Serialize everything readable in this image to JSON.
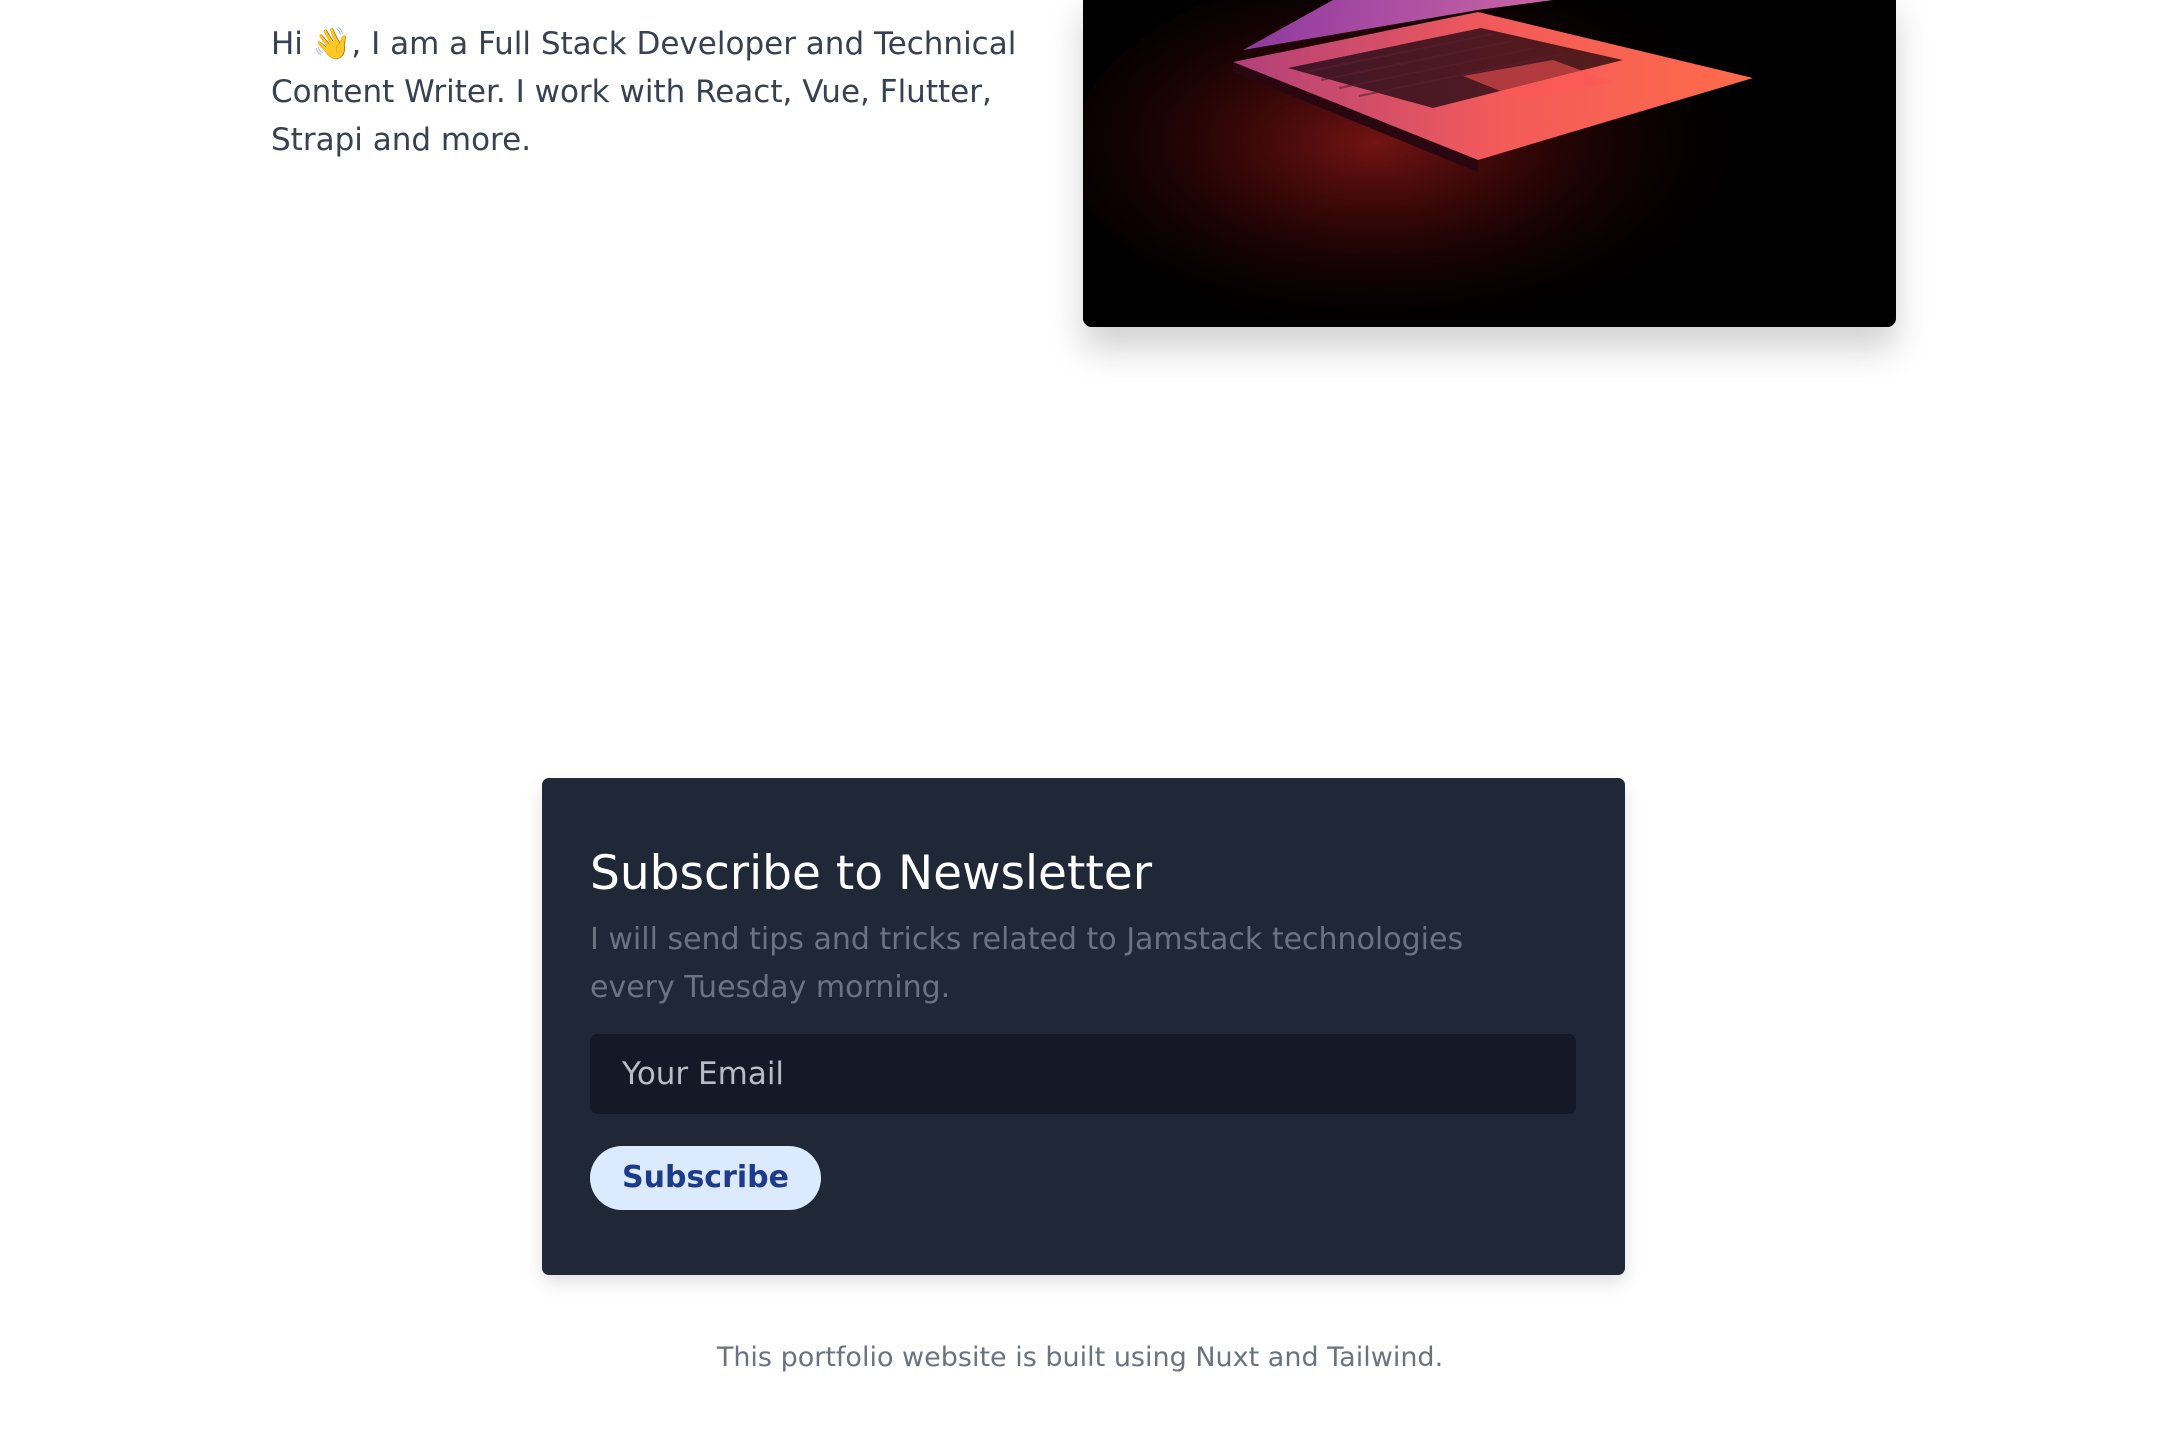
{
  "intro": {
    "text": "Hi 👋, I am a Full Stack Developer and Technical Content Writer. I work with React, Vue, Flutter, Strapi and more."
  },
  "hero_image": {
    "subject": "laptop lit in red and pink light on black background"
  },
  "newsletter": {
    "title": "Subscribe to Newsletter",
    "description": "I will send tips and tricks related to Jamstack technologies every Tuesday morning.",
    "email_placeholder": "Your Email",
    "subscribe_label": "Subscribe"
  },
  "footer": {
    "note": "This portfolio website is built using Nuxt and Tailwind."
  },
  "colors": {
    "card_background": "#202837",
    "input_background": "#141927",
    "button_background": "#dbeafe",
    "button_text": "#1e3a8a",
    "body_text": "#374151",
    "muted_text": "#6b7280"
  }
}
